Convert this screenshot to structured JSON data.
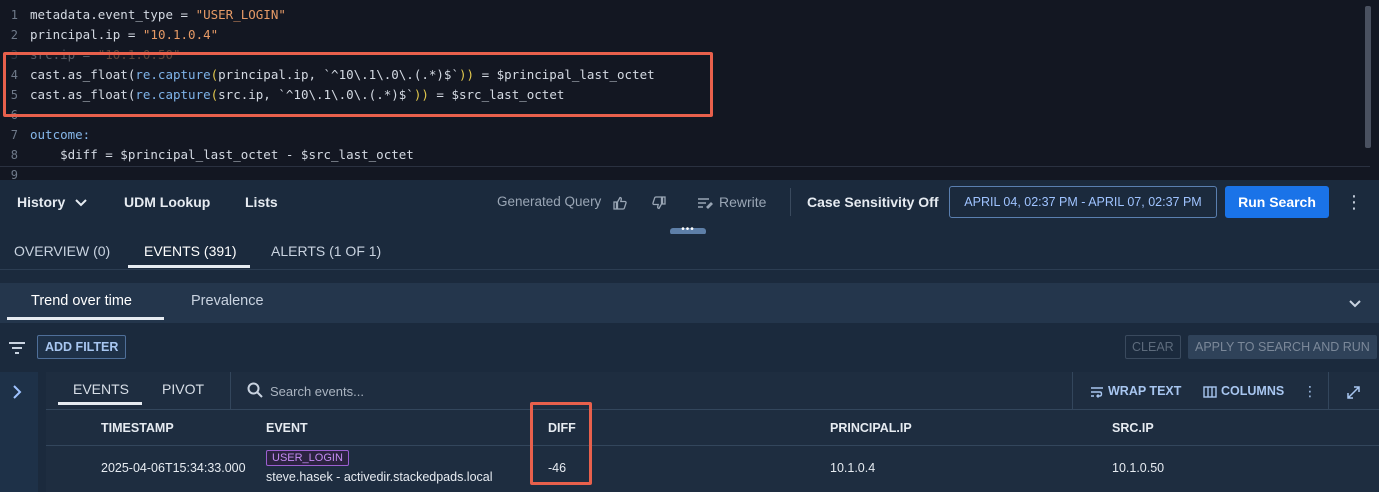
{
  "editor": {
    "lines": [
      {
        "num": "1",
        "segments": [
          {
            "t": "metadata.event_type = ",
            "c": "plain"
          },
          {
            "t": "\"USER_LOGIN\"",
            "c": "str"
          }
        ]
      },
      {
        "num": "2",
        "segments": [
          {
            "t": "principal.ip = ",
            "c": "plain"
          },
          {
            "t": "\"10.1.0.4\"",
            "c": "str"
          }
        ]
      },
      {
        "num": "3",
        "segments": [
          {
            "t": "src.ip = ",
            "c": "plain"
          },
          {
            "t": "\"10.1.0.50\"",
            "c": "str"
          }
        ]
      },
      {
        "num": "4",
        "segments": [
          {
            "t": "cast.as_float(",
            "c": "plain"
          },
          {
            "t": "re.capture",
            "c": "fn"
          },
          {
            "t": "(",
            "c": "paren"
          },
          {
            "t": "principal.ip, ",
            "c": "plain"
          },
          {
            "t": "`^10\\.1\\.0\\.(.*)$`",
            "c": "plain"
          },
          {
            "t": "))",
            "c": "paren"
          },
          {
            "t": " = $principal_last_octet",
            "c": "plain"
          }
        ]
      },
      {
        "num": "5",
        "segments": [
          {
            "t": "cast.as_float(",
            "c": "plain"
          },
          {
            "t": "re.capture",
            "c": "fn"
          },
          {
            "t": "(",
            "c": "paren"
          },
          {
            "t": "src.ip, ",
            "c": "plain"
          },
          {
            "t": "`^10\\.1\\.0\\.(.*)$`",
            "c": "plain"
          },
          {
            "t": "))",
            "c": "paren"
          },
          {
            "t": " = $src_last_octet",
            "c": "plain"
          }
        ]
      },
      {
        "num": "6",
        "segments": []
      },
      {
        "num": "7",
        "segments": [
          {
            "t": "outcome:",
            "c": "kw"
          }
        ]
      },
      {
        "num": "8",
        "segments": [
          {
            "t": "    $diff = $principal_last_octet - $src_last_octet",
            "c": "plain"
          }
        ]
      },
      {
        "num": "9",
        "segments": []
      }
    ]
  },
  "toolbar": {
    "history": "History",
    "udm_lookup": "UDM Lookup",
    "lists": "Lists",
    "generated_query": "Generated Query",
    "rewrite": "Rewrite",
    "case_sensitivity": "Case Sensitivity Off",
    "date_range": "APRIL 04, 02:37 PM - APRIL 07, 02:37 PM",
    "run_search": "Run Search"
  },
  "main_tabs": [
    {
      "label": "OVERVIEW (0)",
      "active": false
    },
    {
      "label": "EVENTS (391)",
      "active": true
    },
    {
      "label": "ALERTS (1 OF 1)",
      "active": false
    }
  ],
  "sub_tabs": [
    {
      "label": "Trend over time",
      "active": true
    },
    {
      "label": "Prevalence",
      "active": false
    }
  ],
  "filter_bar": {
    "add_filter": "ADD FILTER",
    "clear": "CLEAR",
    "apply": "APPLY TO SEARCH AND RUN"
  },
  "events_panel": {
    "tabs": [
      {
        "label": "EVENTS",
        "active": true
      },
      {
        "label": "PIVOT",
        "active": false
      }
    ],
    "search_placeholder": "Search events...",
    "wrap_text": "WRAP TEXT",
    "columns": "COLUMNS",
    "table": {
      "headers": [
        "TIMESTAMP",
        "EVENT",
        "DIFF",
        "PRINCIPAL.IP",
        "SRC.IP"
      ],
      "rows": [
        {
          "timestamp": "2025-04-06T15:34:33.000",
          "event_badge": "USER_LOGIN",
          "event_text": "steve.hasek - activedir.stackedpads.local",
          "diff": "-46",
          "principal_ip": "10.1.0.4",
          "src_ip": "10.1.0.50"
        }
      ]
    }
  },
  "colors": {
    "accent": "#1a73e8",
    "highlight_box": "#e8604c",
    "badge": "#c48bf2",
    "editor_bg": "#131722",
    "panel_bg": "#1b2a3d"
  }
}
